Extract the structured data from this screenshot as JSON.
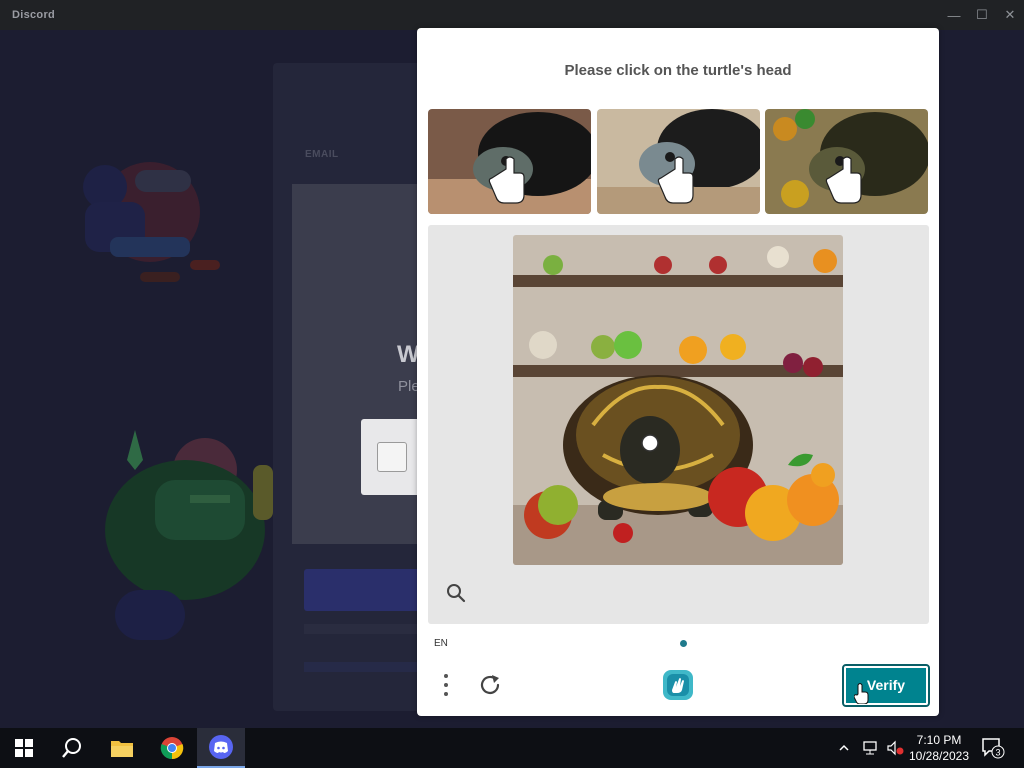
{
  "window": {
    "title": "Discord",
    "minimize": "—",
    "maximize": "☐",
    "close": "✕"
  },
  "login": {
    "email_label": "EMAIL",
    "heading": "W",
    "subtext": "Ple"
  },
  "captcha": {
    "prompt": "Please click on the turtle's head",
    "language": "EN",
    "verify_label": "Verify",
    "accent": "#00838f"
  },
  "clock": {
    "time": "7:10 PM",
    "date": "10/28/2023"
  },
  "notifications": {
    "count": "3"
  }
}
